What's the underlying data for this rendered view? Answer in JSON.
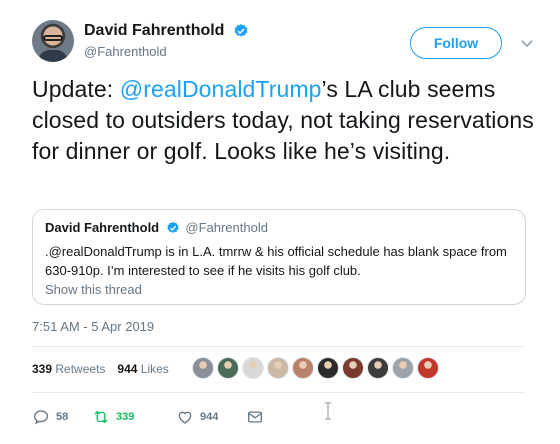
{
  "author": {
    "name": "David Fahrenthold",
    "handle": "@Fahrenthold",
    "verified": true
  },
  "follow_button": {
    "label": "Follow"
  },
  "tweet": {
    "prefix": "Update: ",
    "mention": "@realDonaldTrump",
    "suffix": "’s LA club seems closed to outsiders today, not taking reservations for dinner or golf. Looks like he’s visiting."
  },
  "quoted_tweet": {
    "name": "David Fahrenthold",
    "handle": "@Fahrenthold",
    "text": ".@realDonaldTrump is in L.A. tmrrw & his official schedule has blank space from 630-910p. I’m interested to see if he visits his golf club.",
    "show_thread": "Show this thread"
  },
  "timestamp": "7:51 AM - 5 Apr 2019",
  "stats": {
    "retweets_count": "339",
    "retweets_label": "Retweets",
    "likes_count": "944",
    "likes_label": "Likes"
  },
  "liker_avatars": [
    {
      "icon": "avatar-1",
      "color": "#8a8f99"
    },
    {
      "icon": "avatar-2",
      "color": "#4a6b5a"
    },
    {
      "icon": "avatar-3",
      "color": "#d8d8d8"
    },
    {
      "icon": "avatar-4",
      "color": "#c9b9a6"
    },
    {
      "icon": "avatar-5",
      "color": "#b8836a"
    },
    {
      "icon": "avatar-6",
      "color": "#2b2b2b"
    },
    {
      "icon": "avatar-7",
      "color": "#7a3b2e"
    },
    {
      "icon": "avatar-8",
      "color": "#3c3c3c"
    },
    {
      "icon": "avatar-9",
      "color": "#9da3a8"
    },
    {
      "icon": "avatar-10",
      "color": "#c0392b"
    }
  ],
  "actions": {
    "reply_count": "58",
    "retweet_count": "339",
    "like_count": "944"
  },
  "colors": {
    "accent": "#1da1f2",
    "retweet_green": "#17bf63",
    "muted": "#657786",
    "text": "#14171a"
  }
}
